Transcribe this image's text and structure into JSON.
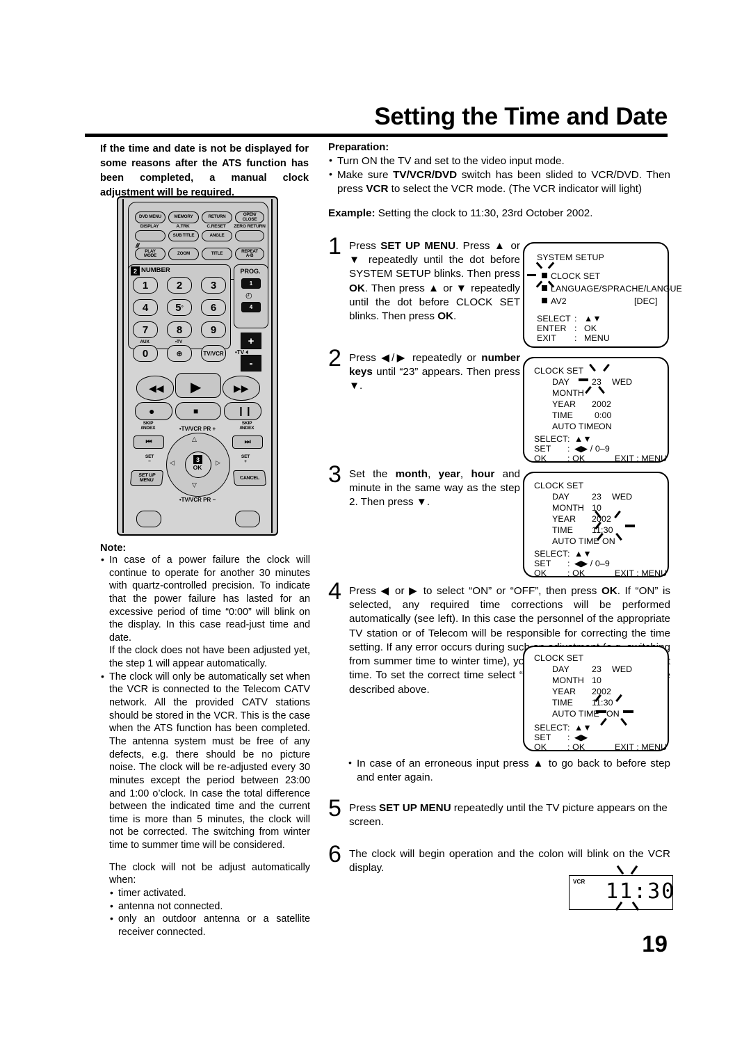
{
  "page": {
    "title": "Setting the Time and Date",
    "number": "19"
  },
  "intro": {
    "text": "If the time and date is not be displayed for some reasons after the ATS function has been completed, a manual clock adjustment will be required."
  },
  "remote": {
    "top_buttons": [
      "DVD MENU",
      "MEMORY",
      "RETURN",
      "OPEN/ CLOSE"
    ],
    "row2_labels": [
      "DISPLAY",
      "A.TRK",
      "C.RESET",
      "ZERO RETURN"
    ],
    "row2_buttons": [
      "",
      "SUB TITLE",
      "ANGLE",
      ""
    ],
    "row3_buttons": [
      "PLAY MODE",
      "ZOOM",
      "TITLE",
      "REPEAT A-B"
    ],
    "number_group_label": "NUMBER",
    "number_group_callout": "2",
    "number_keys": [
      "1",
      "2",
      "3",
      "4",
      "5",
      "6",
      "7",
      "8",
      "9",
      "0"
    ],
    "aux_label": "AUX",
    "tv_label": "TV",
    "tvvcr_label": "TV/VCR",
    "prog_label": "PROG.",
    "prog_buttons": [
      "1",
      "4"
    ],
    "volume": [
      "+",
      "-"
    ],
    "volume_label": "TV",
    "skip_labels": [
      "SKIP /INDEX",
      "SKIP /INDEX"
    ],
    "set_labels": [
      "SET -",
      "SET +"
    ],
    "dpad_top": "TV/VCR PR +",
    "dpad_bottom": "TV/VCR PR -",
    "ok_label": "OK",
    "ok_callout": "3",
    "setup_menu_label": "SET UP MENU",
    "cancel_label": "CANCEL"
  },
  "note": {
    "heading": "Note:",
    "bullets": [
      "In case of a power failure the clock will continue to operate for another 30 minutes with quartz-controlled precision. To indicate that the power failure has lasted for an excessive period of time “0:00” will blink on the display. In this case read-just time and date.",
      "The clock will only be automatically set when the VCR is connected to the Telecom CATV network. All the provided CATV stations should be stored in the VCR. This is the case when the ATS function has been completed. The antenna system must be free of any defects, e.g. there should be no picture noise. The clock will be re-adjusted every 30 minutes except the period between 23:00 and 1:00 o’clock. In case the total difference between the indicated time and the current time is more than 5 minutes, the clock will not be corrected. The switching from winter time to summer time will be considered."
    ],
    "sub_paragraph": "If the clock does not have been adjusted yet, the step 1 will appear automatically.",
    "closing_intro": "The clock will not be adjust automatically when:",
    "closing_bullets": [
      "timer activated.",
      "antenna not connected.",
      "only an outdoor antenna or a satellite receiver connected."
    ]
  },
  "preparation": {
    "heading": "Preparation:",
    "bullets_html": [
      "Turn ON the TV and set to the video input mode.",
      "Make sure <b>TV/VCR/DVD</b> switch has been slided to VCR/DVD. Then press <b>VCR</b> to select the VCR mode. (The VCR indicator will light)"
    ],
    "example_label": "Example:",
    "example_text": " Setting the clock to 11:30, 23rd October 2002."
  },
  "steps": [
    {
      "num": "1",
      "html": "Press <b>SET UP MENU</b>. Press ▲ or ▼ repeatedly until the dot before SYSTEM SETUP blinks. Then press <b>OK</b>. Then press ▲ or ▼ repeatedly until the dot before CLOCK SET blinks. Then press <b>OK</b>."
    },
    {
      "num": "2",
      "html": "Press ◀/▶ repeatedly or <b>number keys</b> until “23” appears. Then press ▼."
    },
    {
      "num": "3",
      "html": "Set the <b>month</b>, <b>year</b>, <b>hour</b> and minute in the same way as the step 2. Then press ▼."
    },
    {
      "num": "4",
      "html": "Press ◀ or ▶ to select “ON” or “OFF”, then press <b>OK</b>. If “ON” is selected, any required time corrections will be performed automatically (see left). In this case the personnel of the appropriate TV station or of Telecom will be responsible for correcting the time setting. If any error occurs during such an adjustment (e.g. switching from summer time to winter time), your clock will show the incorrect time. To set the correct time select “OFF” and follow the procedure described above."
    },
    {
      "num": "5",
      "html": "Press <b>SET UP MENU</b> repeatedly until the TV picture appears on the screen."
    },
    {
      "num": "6",
      "html": "The clock will begin operation and the colon will blink on the VCR display."
    }
  ],
  "step4_note": "In case of an erroneous input press ▲ to go back to before step and enter again.",
  "osd": {
    "screen1": {
      "title": "SYSTEM SETUP",
      "items": [
        "CLOCK SET",
        "LANGUAGE/SPRACHE/LANGUE",
        "AV2"
      ],
      "av2_value": "[DEC]",
      "footer": [
        {
          "key": "SELECT",
          "sep": ":",
          "val": "▲▼"
        },
        {
          "key": "ENTER",
          "sep": ":",
          "val": "OK"
        },
        {
          "key": "EXIT",
          "sep": ":",
          "val": "MENU"
        }
      ]
    },
    "screen2": {
      "title": "CLOCK SET",
      "rows": [
        {
          "label": "DAY",
          "value": "23",
          "extra": "WED"
        },
        {
          "label": "MONTH",
          "value": "",
          "extra": ""
        },
        {
          "label": "YEAR",
          "value": "2002",
          "extra": ""
        },
        {
          "label": "TIME",
          "value": "0:00",
          "extra": ""
        },
        {
          "label": "AUTO TIME",
          "value": "ON",
          "extra": ""
        }
      ],
      "footer": [
        {
          "key": "SELECT",
          "sep": ":",
          "val": "▲▼"
        },
        {
          "key": "SET",
          "sep": ":",
          "val": "◀▶ / 0–9"
        },
        {
          "key": "OK",
          "sep": ": OK",
          "val": "EXIT : MENU"
        }
      ],
      "blink_target": "DAY value 23"
    },
    "screen3": {
      "title": "CLOCK SET",
      "rows": [
        {
          "label": "DAY",
          "value": "23",
          "extra": "WED"
        },
        {
          "label": "MONTH",
          "value": "10",
          "extra": ""
        },
        {
          "label": "YEAR",
          "value": "2002",
          "extra": ""
        },
        {
          "label": "TIME",
          "value": "11:30",
          "extra": ""
        },
        {
          "label": "AUTO TIME",
          "value": "ON",
          "extra": ""
        }
      ],
      "footer": [
        {
          "key": "SELECT",
          "sep": ":",
          "val": "▲▼"
        },
        {
          "key": "SET",
          "sep": ":",
          "val": "◀▶ / 0–9"
        },
        {
          "key": "OK",
          "sep": ": OK",
          "val": "EXIT : MENU"
        }
      ],
      "blink_target": "AUTO TIME value ON"
    },
    "screen4": {
      "title": "CLOCK SET",
      "rows": [
        {
          "label": "DAY",
          "value": "23",
          "extra": "WED"
        },
        {
          "label": "MONTH",
          "value": "10",
          "extra": ""
        },
        {
          "label": "YEAR",
          "value": "2002",
          "extra": ""
        },
        {
          "label": "TIME",
          "value": "11:30",
          "extra": ""
        },
        {
          "label": "AUTO TIME",
          "value": "ON",
          "extra": ""
        }
      ],
      "footer": [
        {
          "key": "SELECT",
          "sep": ":",
          "val": "▲▼"
        },
        {
          "key": "SET",
          "sep": ":",
          "val": "◀▶"
        },
        {
          "key": "OK",
          "sep": ": OK",
          "val": "EXIT : MENU"
        }
      ],
      "blink_target": "AUTO TIME value ON"
    }
  },
  "vcr_display": {
    "indicator": "VCR",
    "time": "11:30",
    "colon_blinks": true
  },
  "colors": {
    "ink": "#000000",
    "paper": "#ffffff",
    "remote_body": "#cfcfcf"
  }
}
